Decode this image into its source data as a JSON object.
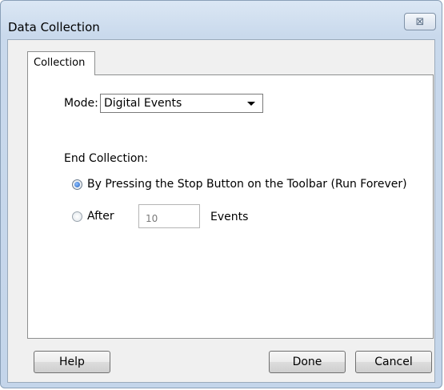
{
  "window": {
    "title": "Data Collection",
    "close_symbol": "⊠"
  },
  "tabs": [
    {
      "label": "Collection",
      "selected": true
    }
  ],
  "mode": {
    "label": "Mode:",
    "selected": "Digital Events"
  },
  "end_collection": {
    "label": "End Collection:",
    "options": [
      {
        "label": "By Pressing the Stop Button on the Toolbar (Run Forever)",
        "checked": true
      },
      {
        "label": "After",
        "checked": false
      }
    ],
    "count_value": "10",
    "count_unit": "Events"
  },
  "buttons": {
    "help": "Help",
    "done": "Done",
    "cancel": "Cancel"
  },
  "colors": {
    "title_bar": "#c9d9ec",
    "radio_selected": "#1f5fbf"
  }
}
